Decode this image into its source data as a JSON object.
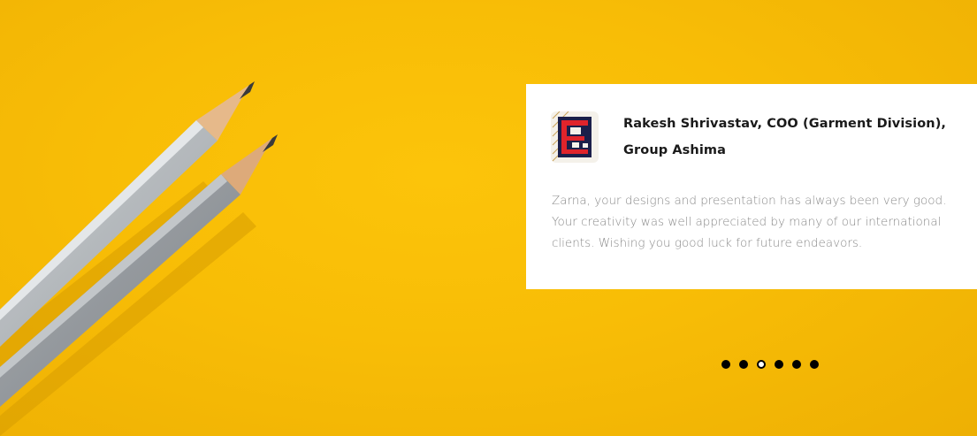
{
  "testimonial": {
    "author": "Rakesh Shrivastav, COO (Garment Division), Group Ashima",
    "quote": "Zarna, your designs and presentation has always been very good. Your creativity was well appreciated by many of our international clients. Wishing you good luck for future endeavors.",
    "logo_icon": "ashima-logo-icon"
  },
  "carousel": {
    "slide_count": 6,
    "active_index": 2
  },
  "colors": {
    "background": "#fcc40a",
    "card": "#ffffff",
    "author_text": "#1a1a1a",
    "quote_text": "#8a8a8a",
    "dot": "#000000"
  }
}
